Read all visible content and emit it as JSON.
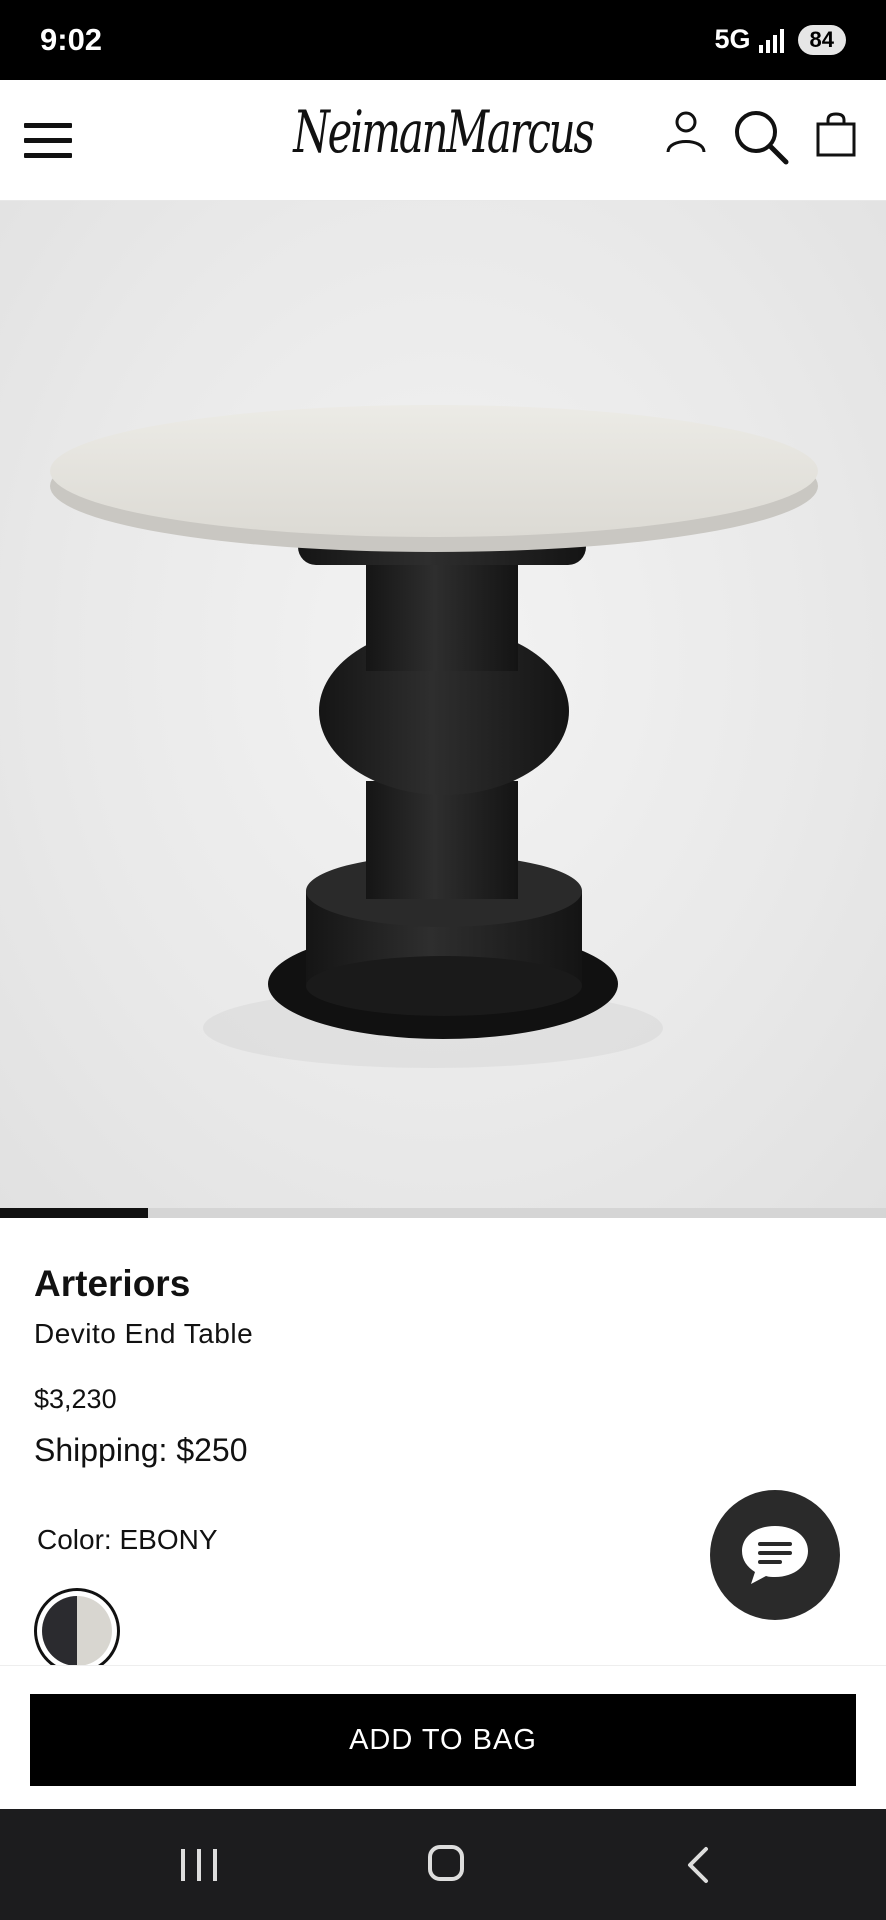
{
  "status_bar": {
    "time": "9:02",
    "network": "5G",
    "battery": "84"
  },
  "header": {
    "logo_text": "NeimanMarcus",
    "icons": [
      "menu-icon",
      "account-icon",
      "search-icon",
      "shopping-bag-icon"
    ]
  },
  "carousel": {
    "progress_fraction": 0.167
  },
  "product": {
    "brand": "Arteriors",
    "name": "Devito End Table",
    "price": "$3,230",
    "shipping": "Shipping: $250",
    "color_label": "Color: EBONY",
    "swatch_colors": [
      "#2b2b2f",
      "#d8d6d0"
    ]
  },
  "actions": {
    "add_to_bag": "ADD TO BAG",
    "chat_icon": "chat-bubble-icon"
  },
  "colors": {
    "primary": "#000000",
    "chat_bg": "#2a2a2a",
    "nav_bg": "#1c1c1e"
  },
  "nav_bar": {
    "icons": [
      "recent-apps-icon",
      "home-icon",
      "back-icon"
    ]
  }
}
